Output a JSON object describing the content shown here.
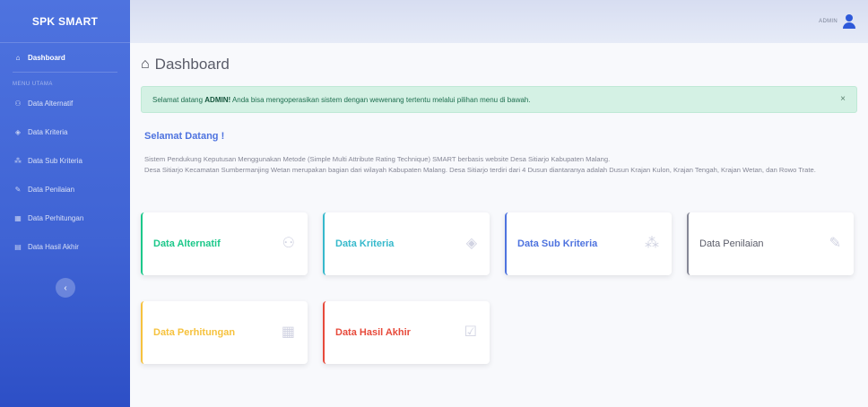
{
  "sidebar": {
    "brand": "SPK SMART",
    "active_item": {
      "label": "Dashboard",
      "icon": "tachometer-icon"
    },
    "heading": "MENU UTAMA",
    "items": [
      {
        "label": "Data Alternatif",
        "icon": "users-icon"
      },
      {
        "label": "Data Kriteria",
        "icon": "cube-icon"
      },
      {
        "label": "Data Sub Kriteria",
        "icon": "cubes-icon"
      },
      {
        "label": "Data Penilaian",
        "icon": "edit-icon"
      },
      {
        "label": "Data Perhitungan",
        "icon": "calculator-icon"
      },
      {
        "label": "Data Hasil Akhir",
        "icon": "chart-icon"
      }
    ],
    "toggle_icon": "chevron-left-icon"
  },
  "topbar": {
    "user_name": "ADMIN"
  },
  "page": {
    "title": "Dashboard"
  },
  "alert": {
    "prefix": "Selamat datang ",
    "strong": "ADMIN!",
    "suffix": " Anda bisa mengoperasikan sistem dengan wewenang tertentu melalui pilihan menu di bawah.",
    "close": "×"
  },
  "welcome": {
    "title": "Selamat Datang !",
    "line1": "Sistem Pendukung Keputusan Menggunakan Metode (Simple Multi Attribute Rating Technique) SMART berbasis website Desa Sitiarjo Kabupaten Malang.",
    "line2": "Desa Sitiarjo Kecamatan Sumbermanjing Wetan merupakan bagian dari wilayah Kabupaten Malang. Desa Sitiarjo terdiri dari 4 Dusun diantaranya adalah Dusun Krajan Kulon, Krajan Tengah, Krajan Wetan, dan Rowo Trate."
  },
  "cards": [
    {
      "label": "Data Alternatif",
      "icon": "users-icon",
      "color": "#1cc88a"
    },
    {
      "label": "Data Kriteria",
      "icon": "cube-icon",
      "color": "#36b9cc"
    },
    {
      "label": "Data Sub Kriteria",
      "icon": "cubes-icon",
      "color": "#4e73df"
    },
    {
      "label": "Data Penilaian",
      "icon": "edit-icon",
      "color": "#858796"
    },
    {
      "label": "Data Perhitungan",
      "icon": "calculator-icon",
      "color": "#f6c23e"
    },
    {
      "label": "Data Hasil Akhir",
      "icon": "calendar-check-icon",
      "color": "#e74a3b"
    }
  ]
}
